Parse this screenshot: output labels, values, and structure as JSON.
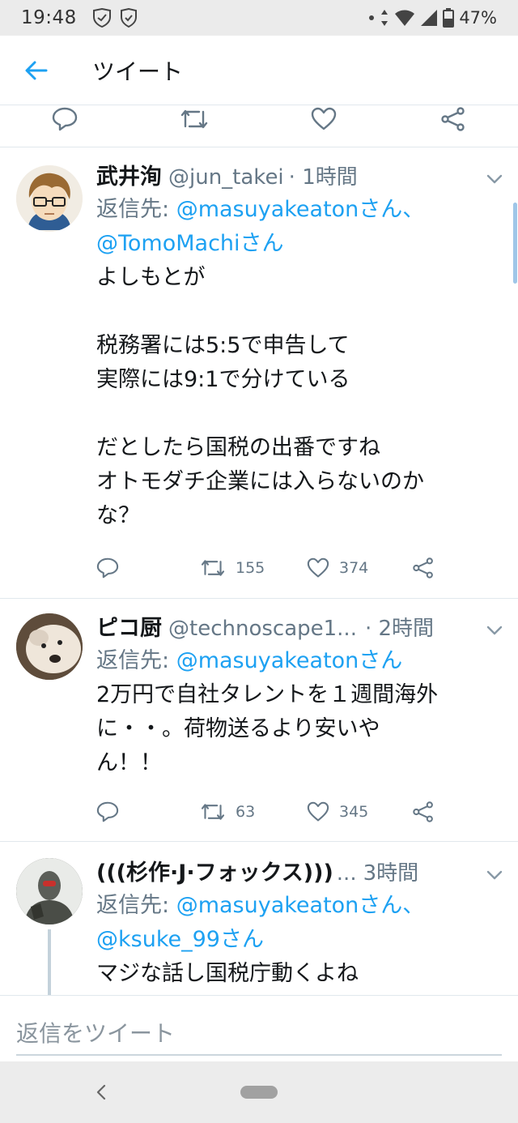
{
  "status_bar": {
    "time": "19:48",
    "battery": "47%",
    "icons": [
      "shield-check-icon",
      "shield-icon",
      "dot-icon",
      "data-arrows-icon",
      "wifi-icon",
      "cell-signal-icon",
      "battery-icon"
    ]
  },
  "header": {
    "title": "ツイート",
    "back_icon": "arrow-left-icon"
  },
  "tweets": [
    {
      "name": "武井洵",
      "handle": "@jun_takei",
      "time": "· 1時間",
      "reply_label": "返信先: ",
      "reply_mentions_line1": "@masuyakeatonさん、",
      "reply_mentions_line2": "@TomoMachiさん",
      "text": "よしもとが\n\n税務署には5:5で申告して\n実際には9:1で分けている\n\nだとしたら国税の出番ですね\nオトモダチ企業には入らないのか\nな？",
      "retweets": "155",
      "likes": "374"
    },
    {
      "name": "ピコ厨",
      "handle": "@technoscape1...",
      "time": "· 2時間",
      "reply_label": "返信先: ",
      "reply_mentions_line1": "@masuyakeatonさん",
      "text": "2万円で自社タレントを１週間海外\nに・・。荷物送るより安いや\nん！！",
      "retweets": "63",
      "likes": "345"
    },
    {
      "name": "(((杉作·J·フォックス)))",
      "handle": "...",
      "time": "3時間",
      "reply_label": "返信先: ",
      "reply_mentions_line1": "@masuyakeatonさん、",
      "reply_mentions_line2": "@ksuke_99さん",
      "text": "マジな話し国税庁動くよね"
    }
  ],
  "composer": {
    "placeholder": "返信をツイート"
  },
  "colors": {
    "accent": "#1da1f2",
    "secondary_text": "#657786",
    "divider": "#e1e8ed"
  }
}
